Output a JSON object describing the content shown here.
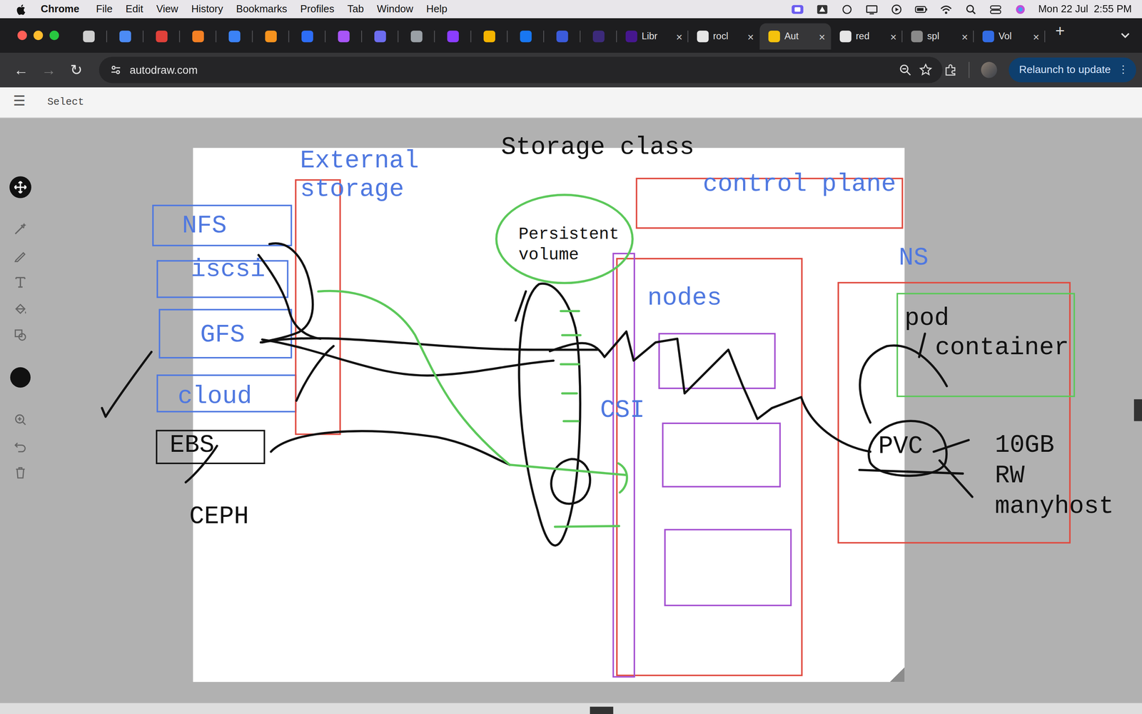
{
  "menubar": {
    "app": "Chrome",
    "items": [
      "File",
      "Edit",
      "View",
      "History",
      "Bookmarks",
      "Profiles",
      "Tab",
      "Window",
      "Help"
    ],
    "clock": "Mon 22 Jul  2:55 PM"
  },
  "tabs": [
    {
      "kind": "pinned",
      "selected": false,
      "color": "#cfcfcf"
    },
    {
      "kind": "pinned",
      "selected": false,
      "color": "#4c8bf5"
    },
    {
      "kind": "pinned",
      "selected": false,
      "color": "#e0413a"
    },
    {
      "kind": "pinned",
      "selected": false,
      "color": "#f48024"
    },
    {
      "kind": "pinned",
      "selected": false,
      "color": "#3b82f6"
    },
    {
      "kind": "pinned",
      "selected": false,
      "color": "#f6931e"
    },
    {
      "kind": "pinned",
      "selected": false,
      "color": "#2d6df6"
    },
    {
      "kind": "pinned",
      "selected": false,
      "color": "#a855f7"
    },
    {
      "kind": "pinned",
      "selected": false,
      "color": "#6d6df0"
    },
    {
      "kind": "pinned",
      "selected": false,
      "color": "#9aa0a6"
    },
    {
      "kind": "pinned",
      "selected": false,
      "color": "#8b3dff"
    },
    {
      "kind": "pinned",
      "selected": false,
      "color": "#f5b400"
    },
    {
      "kind": "pinned",
      "selected": false,
      "color": "#1877f2"
    },
    {
      "kind": "pinned",
      "selected": false,
      "color": "#3b5bdb"
    },
    {
      "kind": "pinned",
      "selected": false,
      "color": "#3c2a7a"
    },
    {
      "kind": "regular",
      "label": "Libr",
      "close": "×",
      "selected": false,
      "color": "#46178f"
    },
    {
      "kind": "regular",
      "label": "rocl",
      "close": "×",
      "selected": false,
      "color": "#e6e6e6"
    },
    {
      "kind": "regular",
      "label": "Aut",
      "close": "×",
      "selected": true,
      "color": "#f4c20d"
    },
    {
      "kind": "regular",
      "label": "red",
      "close": "×",
      "selected": false,
      "color": "#e6e6e6"
    },
    {
      "kind": "regular",
      "label": "spl",
      "close": "×",
      "selected": false,
      "color": "#8a8a8a"
    },
    {
      "kind": "regular",
      "label": "Vol",
      "close": "×",
      "selected": false,
      "color": "#326ce5"
    }
  ],
  "new_tab": "+",
  "toolbar": {
    "back": {
      "glyph": "←",
      "disabled": false
    },
    "forward": {
      "glyph": "→",
      "disabled": true
    },
    "reload": {
      "glyph": "↻",
      "disabled": false
    },
    "address": "autodraw.com",
    "relaunch": "Relaunch to update",
    "relaunch_menu": "⋮"
  },
  "app": {
    "menu": "☰",
    "mode": "Select"
  },
  "tools": [
    {
      "kind": "move",
      "selected": true
    },
    {
      "kind": "autodraw",
      "selected": false
    },
    {
      "kind": "draw",
      "selected": false
    },
    {
      "kind": "type",
      "selected": false
    },
    {
      "kind": "fill",
      "selected": false
    },
    {
      "kind": "shape",
      "selected": false
    },
    {
      "kind": "color",
      "selected": false,
      "color": "#111111"
    },
    {
      "kind": "zoom",
      "selected": false
    },
    {
      "kind": "undo",
      "selected": false
    },
    {
      "kind": "delete",
      "selected": false
    }
  ],
  "diagram": {
    "labels": [
      {
        "text": "Storage class",
        "color": "#111111"
      },
      {
        "text": "External\nstorage",
        "color": "#4f78e0"
      },
      {
        "text": "control plane",
        "color": "#4f78e0"
      },
      {
        "text": "Persistent\nvolume",
        "color": "#111111"
      },
      {
        "text": "NS",
        "color": "#4f78e0"
      },
      {
        "text": "nodes",
        "color": "#4f78e0"
      },
      {
        "text": "pod",
        "color": "#111111"
      },
      {
        "text": "container",
        "color": "#111111"
      },
      {
        "text": "CSI",
        "color": "#4f78e0"
      },
      {
        "text": "NFS",
        "color": "#4f78e0"
      },
      {
        "text": "iscsi",
        "color": "#4f78e0"
      },
      {
        "text": "GFS",
        "color": "#4f78e0"
      },
      {
        "text": "cloud",
        "color": "#4f78e0"
      },
      {
        "text": "EBS",
        "color": "#111111"
      },
      {
        "text": "CEPH",
        "color": "#111111"
      },
      {
        "text": "PVC",
        "color": "#111111"
      },
      {
        "text": "10GB\nRW\nmanyhost",
        "color": "#111111"
      }
    ],
    "boxes": [
      {
        "kind": "rect",
        "color": "#4f78e0"
      },
      {
        "kind": "rect",
        "color": "#4f78e0"
      },
      {
        "kind": "rect",
        "color": "#4f78e0"
      },
      {
        "kind": "rect",
        "color": "#4f78e0"
      },
      {
        "kind": "rect",
        "color": "#111111"
      },
      {
        "kind": "rect",
        "color": "#e04a3f"
      },
      {
        "kind": "rect",
        "color": "#e04a3f"
      },
      {
        "kind": "rect",
        "color": "#e04a3f"
      },
      {
        "kind": "rect",
        "color": "#a44fd1"
      },
      {
        "kind": "rect",
        "color": "#a44fd1"
      },
      {
        "kind": "rect",
        "color": "#a44fd1"
      },
      {
        "kind": "rect",
        "color": "#a44fd1"
      },
      {
        "kind": "rect",
        "color": "#e04a3f"
      },
      {
        "kind": "rect",
        "color": "#5cc85a"
      },
      {
        "kind": "ellipse",
        "color": "#5cc85a"
      }
    ]
  }
}
